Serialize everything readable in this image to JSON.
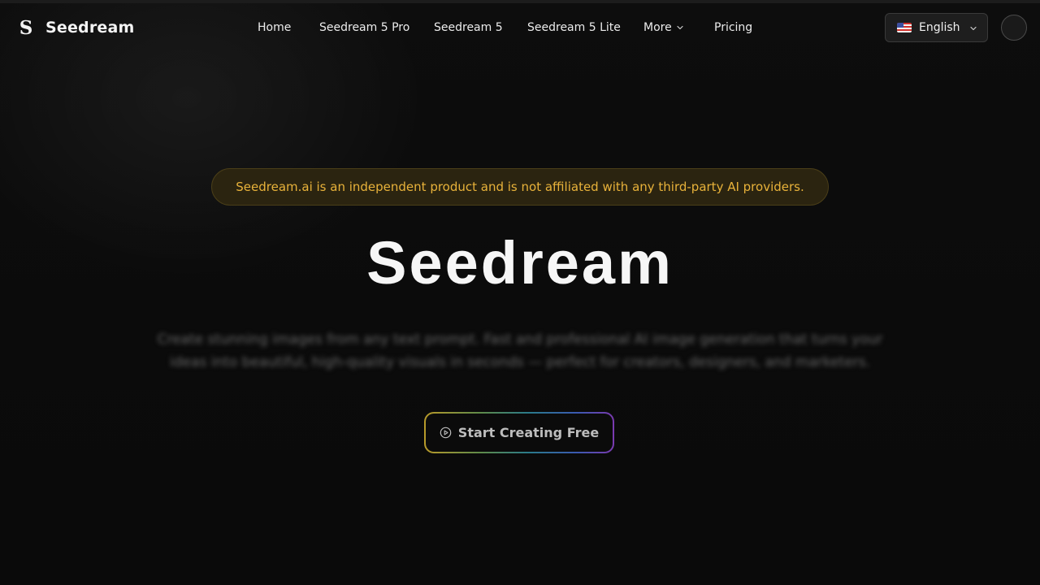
{
  "brand": {
    "logo_letter": "S",
    "name": "Seedream"
  },
  "nav": {
    "home": "Home",
    "pro": "Seedream 5 Pro",
    "standard": "Seedream 5",
    "lite": "Seedream 5 Lite",
    "more": "More",
    "pricing": "Pricing"
  },
  "language": {
    "label": "English",
    "flag_icon": "us-flag-icon"
  },
  "hero": {
    "notice": "Seedream.ai is an independent product and is not affiliated with any third-party AI providers.",
    "title": "Seedream",
    "subtitle": "Create stunning images from any text prompt. Fast and professional AI image generation that turns your ideas into beautiful, high-quality visuals in seconds — perfect for creators, designers, and marketers.",
    "cta_label": "Start Creating Free",
    "cta_icon": "play-circle-icon"
  },
  "colors": {
    "background": "#0b0b0b",
    "notice_text": "#e8b23a",
    "notice_bg": "#2b2410"
  }
}
